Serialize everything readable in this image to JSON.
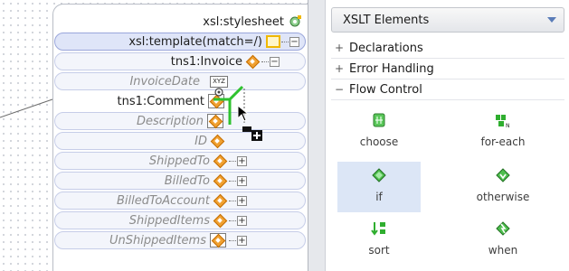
{
  "mapper": {
    "stylesheet_label": "xsl:stylesheet",
    "template_label": "xsl:template(match=/)",
    "invoice_label": "tns1:Invoice",
    "xyz_tag": "XYZ",
    "children": [
      {
        "label": "InvoiceDate",
        "style": "italic"
      },
      {
        "label": "tns1:Comment",
        "style": "normal"
      },
      {
        "label": "Description",
        "style": "italic"
      },
      {
        "label": "ID",
        "style": "italic"
      },
      {
        "label": "ShippedTo",
        "style": "italic"
      },
      {
        "label": "BilledTo",
        "style": "italic"
      },
      {
        "label": "BilledToAccount",
        "style": "italic"
      },
      {
        "label": "ShippedItems",
        "style": "italic"
      },
      {
        "label": "UnShippedItems",
        "style": "italic"
      }
    ]
  },
  "palette": {
    "selected": "XSLT Elements",
    "categories": [
      {
        "label": "Declarations",
        "state": "collapsed",
        "sign": "+"
      },
      {
        "label": "Error Handling",
        "state": "collapsed",
        "sign": "+"
      },
      {
        "label": "Flow Control",
        "state": "expanded",
        "sign": "−"
      }
    ],
    "items": [
      {
        "label": "choose",
        "icon": "choose-icon"
      },
      {
        "label": "for-each",
        "icon": "for-each-icon"
      },
      {
        "label": "if",
        "icon": "if-icon",
        "selected": true
      },
      {
        "label": "otherwise",
        "icon": "otherwise-icon"
      },
      {
        "label": "sort",
        "icon": "sort-icon"
      },
      {
        "label": "when",
        "icon": "when-icon"
      }
    ]
  },
  "colors": {
    "accent_orange": "#f0a030",
    "drop_green": "#2fc22f",
    "selection_blue": "#dce6f6"
  }
}
